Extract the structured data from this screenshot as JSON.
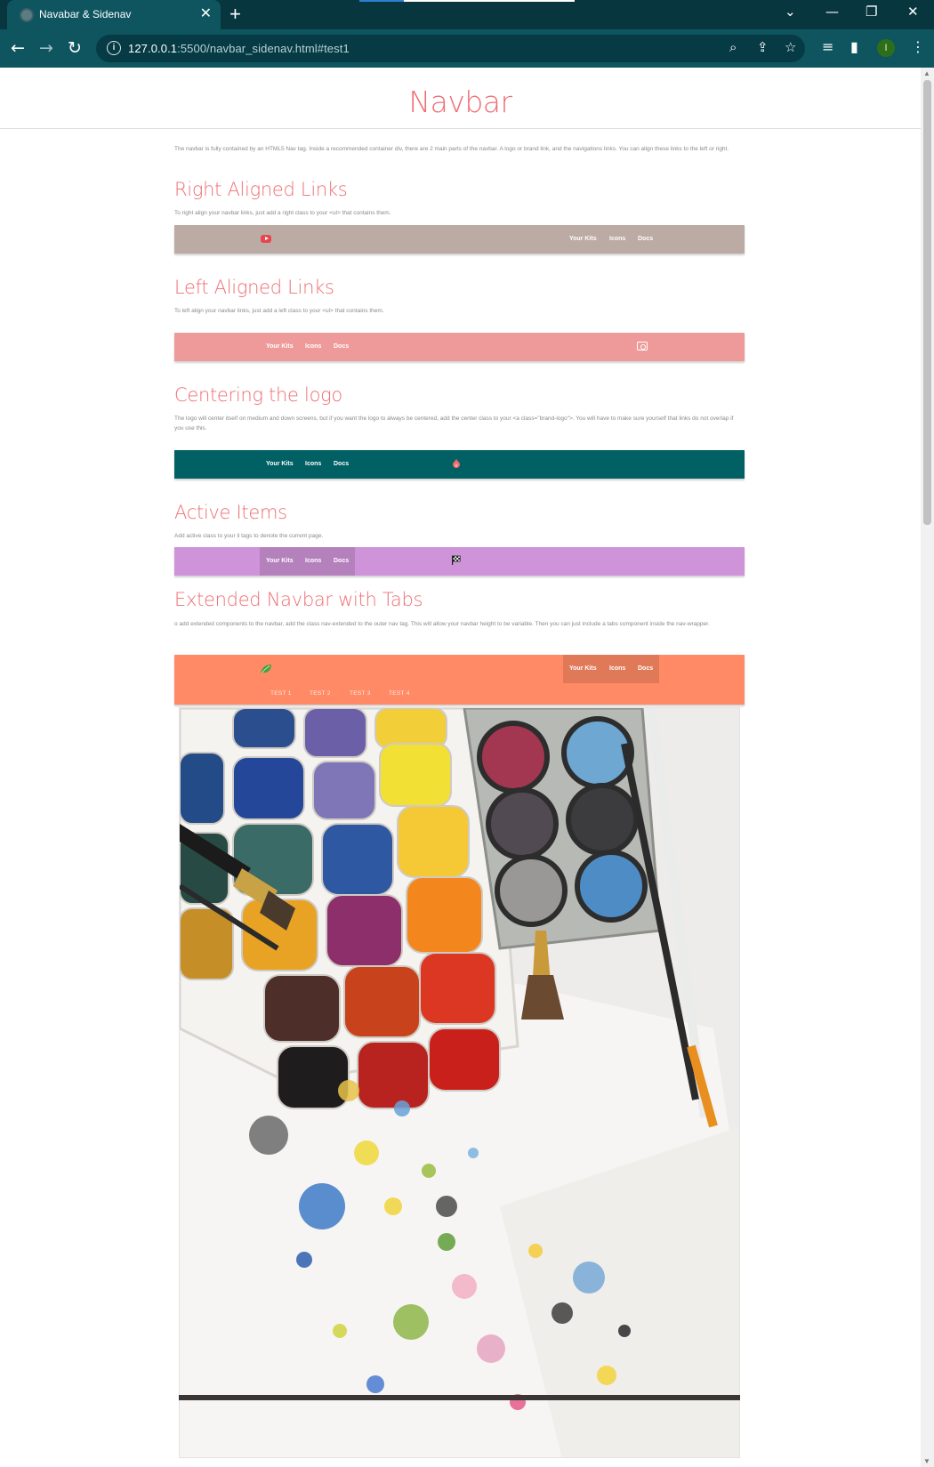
{
  "browser": {
    "tab_title": "Navabar & Sidenav",
    "tab_close": "✕",
    "new_tab": "+",
    "url_host": "127.0.0.1",
    "url_path": ":5500/navbar_sidenav.html#test1",
    "profile_initial": "I",
    "controls": {
      "dropdown": "⌄",
      "minimize": "—",
      "restore": "❐",
      "close": "✕"
    }
  },
  "page": {
    "title": "Navbar",
    "intro": "The navbar is fully contained by an HTML5 Nav tag. Inside a recommended container div, there are 2 main parts of the navbar. A logo or brand link, and the navigations links. You can align these links to the left or right."
  },
  "sections": {
    "right_aligned": {
      "heading": "Right Aligned Links",
      "text": "To right align your navbar links, just add a right class to your <ul> that contains them.",
      "bg": "#bcaaa4",
      "links": [
        "Your Kits",
        "Icons",
        "Docs"
      ],
      "logo_icon": "youtube-icon"
    },
    "left_aligned": {
      "heading": "Left Aligned Links",
      "text": "To left align your navbar links, just add a left class to your <ul> that contains them.",
      "bg": "#ef9a9a",
      "links": [
        "Your Kits",
        "Icons",
        "Docs"
      ],
      "logo_icon": "camera-icon"
    },
    "centering": {
      "heading": "Centering the logo",
      "text": "The logo will center itself on medium and down screens, but if you want the logo to always be centered, add the center class to your <a class=\"brand-logo\">. You will have to make sure yourself that links do not overlap if you use this.",
      "bg": "#006064",
      "links": [
        "Your Kits",
        "Icons",
        "Docs"
      ],
      "logo_icon": "flame-icon"
    },
    "active": {
      "heading": "Active Items",
      "text": "Add active class to your li tags to denote the current page.",
      "bg": "#ce93d8",
      "links": [
        "Your Kits",
        "Icons",
        "Docs"
      ],
      "logo_icon": "flag-icon"
    },
    "extended": {
      "heading": "Extended Navbar with Tabs",
      "text": "o add extended components to the navbar, add the class nav-extended to the outer nav tag. This will allow your navbar height to be variable. Then you can just include a tabs component inside the nav-wrapper.",
      "bg": "#ff8a65",
      "links": [
        "Your Kits",
        "Icons",
        "Docs"
      ],
      "tabs": [
        "TEST 1",
        "TEST 2",
        "TEST 3",
        "TEST 4"
      ],
      "logo_icon": "leaf-icon"
    }
  },
  "image": {
    "subject": "watercolor-palette-photo"
  }
}
